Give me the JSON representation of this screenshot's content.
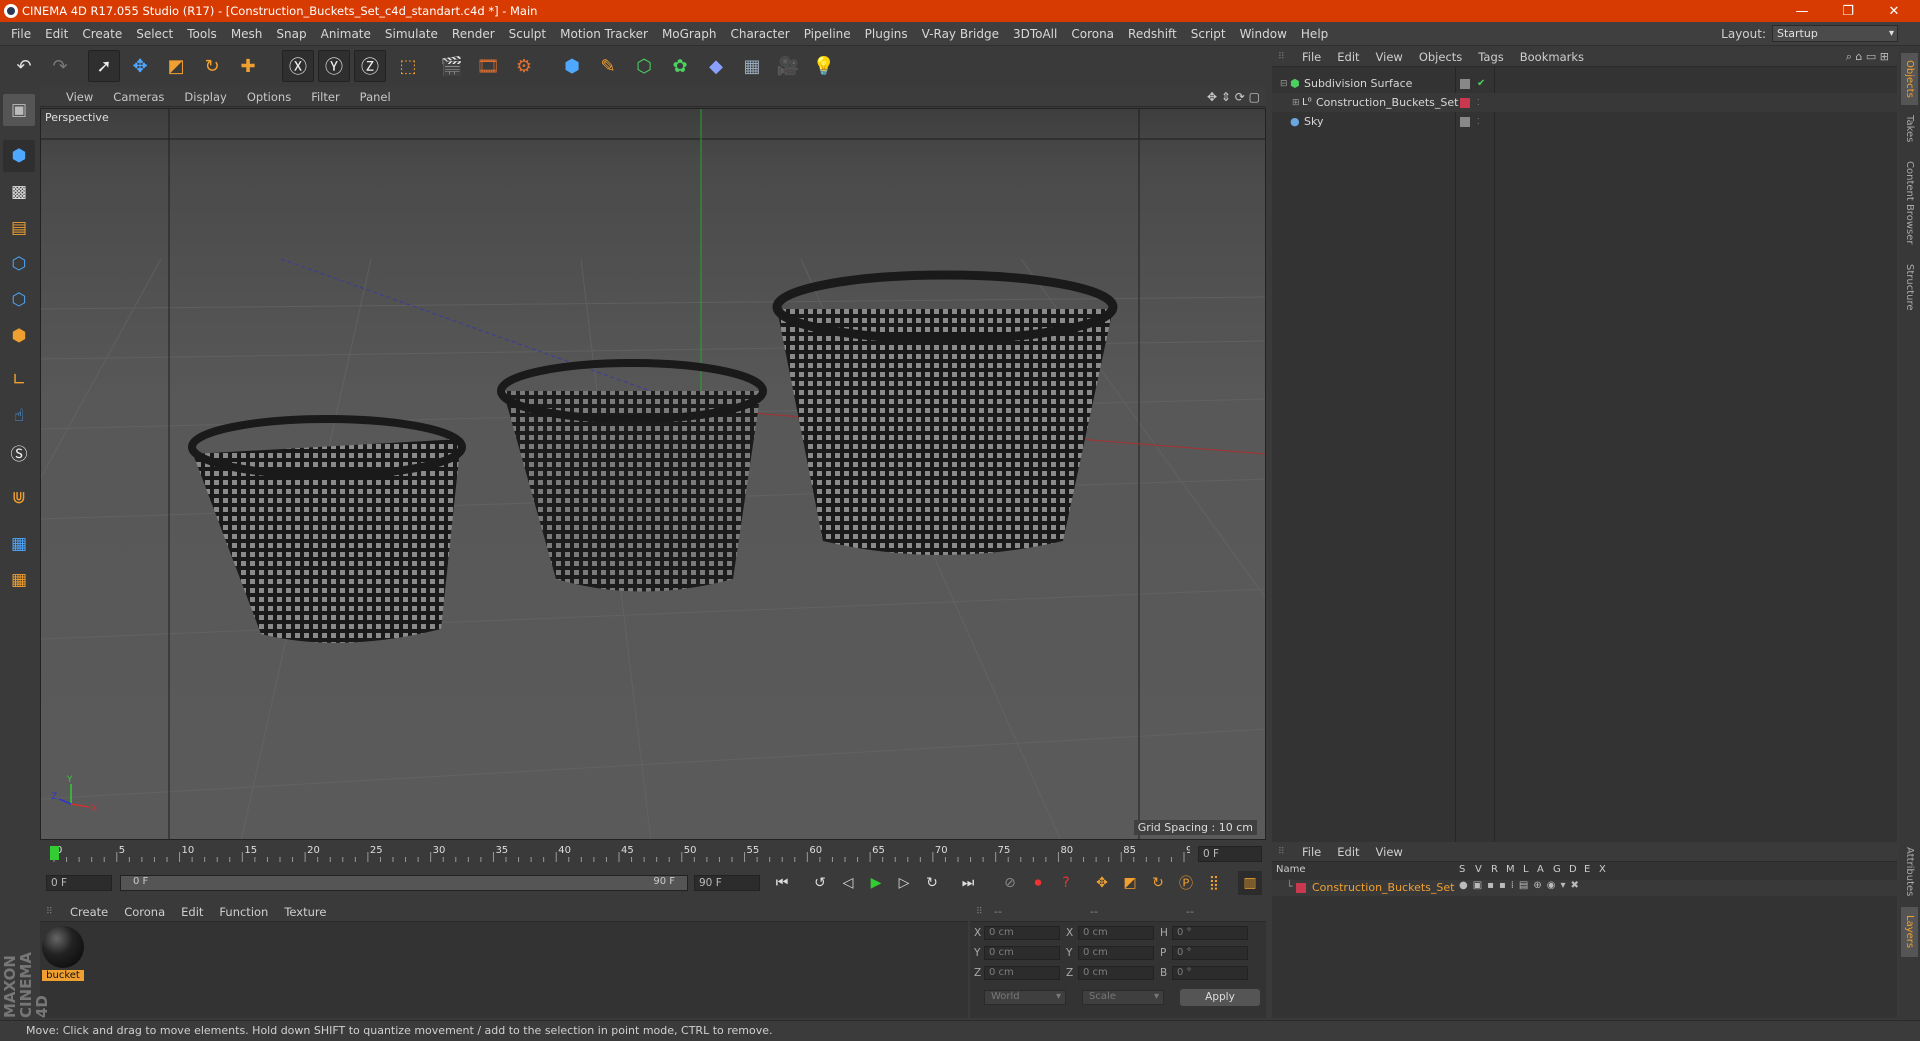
{
  "window": {
    "title": "CINEMA 4D R17.055 Studio (R17) - [Construction_Buckets_Set_c4d_standart.c4d *] - Main",
    "controls": [
      "—",
      "❐",
      "✕"
    ]
  },
  "menu": [
    "File",
    "Edit",
    "Create",
    "Select",
    "Tools",
    "Mesh",
    "Snap",
    "Animate",
    "Simulate",
    "Render",
    "Sculpt",
    "Motion Tracker",
    "MoGraph",
    "Character",
    "Pipeline",
    "Plugins",
    "V-Ray Bridge",
    "3DToAll",
    "Corona",
    "Redshift",
    "Script",
    "Window",
    "Help"
  ],
  "layout": {
    "label": "Layout:",
    "value": "Startup"
  },
  "viewport": {
    "menu": [
      "View",
      "Cameras",
      "Display",
      "Options",
      "Filter",
      "Panel"
    ],
    "label": "Perspective",
    "grid_spacing": "Grid Spacing : 10 cm",
    "axis": {
      "y": "Y",
      "x": "X",
      "z": "Z"
    }
  },
  "object_manager": {
    "menu": [
      "File",
      "Edit",
      "View",
      "Objects",
      "Tags",
      "Bookmarks"
    ],
    "objects": [
      {
        "name": "Subdivision Surface"
      },
      {
        "name": "Construction_Buckets_Set"
      },
      {
        "name": "Sky"
      }
    ]
  },
  "right_tabs": [
    "Objects",
    "Takes",
    "Content Browser",
    "Structure",
    "Attributes",
    "Layers"
  ],
  "timeline": {
    "ticks": [
      "0",
      "5",
      "10",
      "15",
      "20",
      "25",
      "30",
      "35",
      "40",
      "45",
      "50",
      "55",
      "60",
      "65",
      "70",
      "75",
      "80",
      "85",
      "90"
    ],
    "current_frame": "0 F",
    "start_field": "0 F",
    "range_start": "0 F",
    "range_end": "90 F",
    "end_field": "90 F"
  },
  "material_manager": {
    "menu": [
      "Create",
      "Corona",
      "Edit",
      "Function",
      "Texture"
    ],
    "materials": [
      {
        "name": "bucket"
      }
    ]
  },
  "coordinates": {
    "header": [
      "--",
      "--",
      "--"
    ],
    "rows": [
      {
        "a": "X",
        "av": "0 cm",
        "b": "X",
        "bv": "0 cm",
        "c": "H",
        "cv": "0 °"
      },
      {
        "a": "Y",
        "av": "0 cm",
        "b": "Y",
        "bv": "0 cm",
        "c": "P",
        "cv": "0 °"
      },
      {
        "a": "Z",
        "av": "0 cm",
        "b": "Z",
        "bv": "0 cm",
        "c": "B",
        "cv": "0 °"
      }
    ],
    "mode1": "World",
    "mode2": "Scale",
    "apply": "Apply"
  },
  "layer_manager": {
    "menu": [
      "File",
      "Edit",
      "View"
    ],
    "columns": [
      "Name",
      "S",
      "V",
      "R",
      "M",
      "L",
      "A",
      "G",
      "D",
      "E",
      "X"
    ],
    "layers": [
      {
        "name": "Construction_Buckets_Set"
      }
    ]
  },
  "brand": "MAXON CINEMA 4D",
  "status": "Move: Click and drag to move elements. Hold down SHIFT to quantize movement / add to the selection in point mode, CTRL to remove.",
  "colors": {
    "titlebar": "#d83b01",
    "accent": "#f0a030",
    "layer": "#c8394f"
  }
}
